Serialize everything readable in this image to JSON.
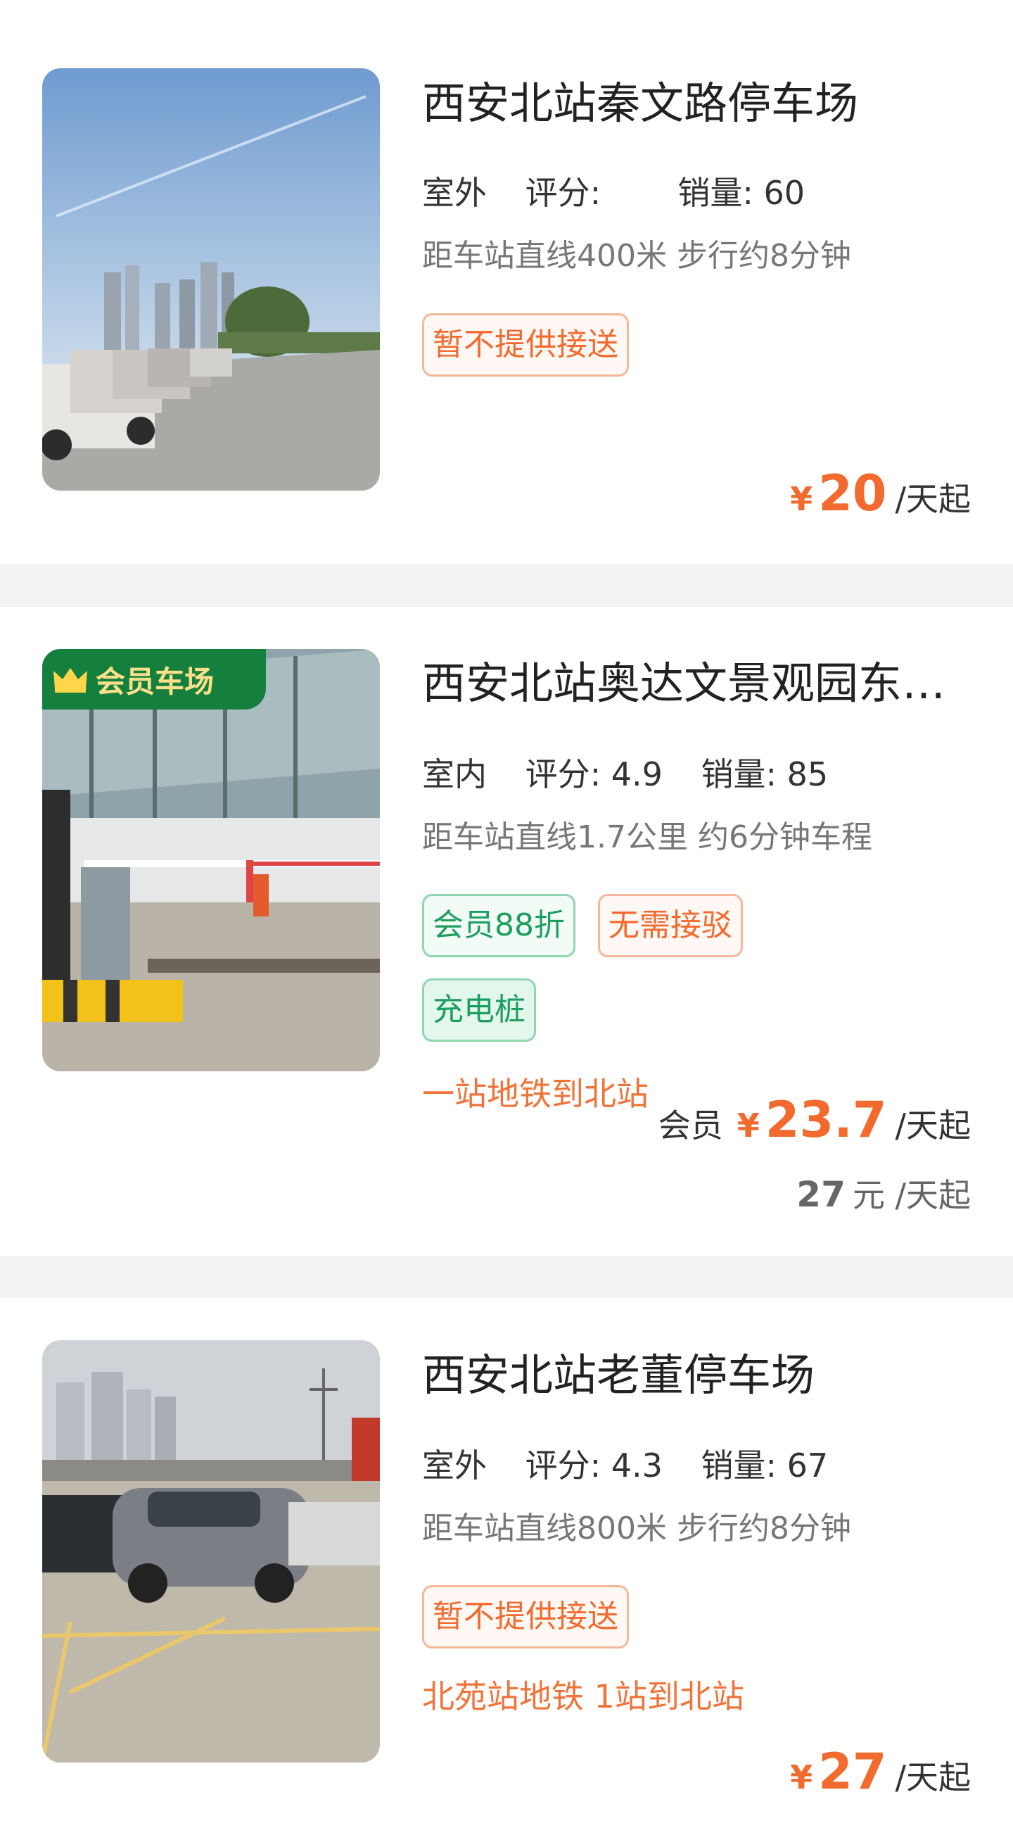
{
  "lots": [
    {
      "name": "西安北站秦文路停车场",
      "type": "室外",
      "score_label": "评分:",
      "score": "",
      "sales_label": "销量:",
      "sales": "60",
      "distance": "距车站直线400米 步行约8分钟",
      "tags": [
        "暂不提供接送"
      ],
      "currency": "¥",
      "price": "20",
      "unit": "/天起"
    },
    {
      "badge": "会员车场",
      "name": "西安北站奥达文景观园东…",
      "type": "室内",
      "score_label": "评分:",
      "score": "4.9",
      "sales_label": "销量:",
      "sales": "85",
      "distance": "距车站直线1.7公里 约6分钟车程",
      "tags": [
        "会员88折",
        "无需接驳",
        "充电桩"
      ],
      "metro": "一站地铁到北站",
      "member_label": "会员",
      "currency": "¥",
      "price": "23.7",
      "unit": "/天起",
      "original_price": "27",
      "original_unit": "元 /天起"
    },
    {
      "name": "西安北站老董停车场",
      "type": "室外",
      "score_label": "评分:",
      "score": "4.3",
      "sales_label": "销量:",
      "sales": "67",
      "distance": "距车站直线800米 步行约8分钟",
      "tags": [
        "暂不提供接送"
      ],
      "metro": "北苑站地铁 1站到北站",
      "currency": "¥",
      "price": "27",
      "unit": "/天起"
    }
  ],
  "colors": {
    "accent_orange": "#f26a2e",
    "accent_green": "#1c9e5e",
    "badge_green": "#15803d",
    "badge_text": "#ffe08a"
  },
  "icons": {
    "member_badge": "crown-icon"
  }
}
